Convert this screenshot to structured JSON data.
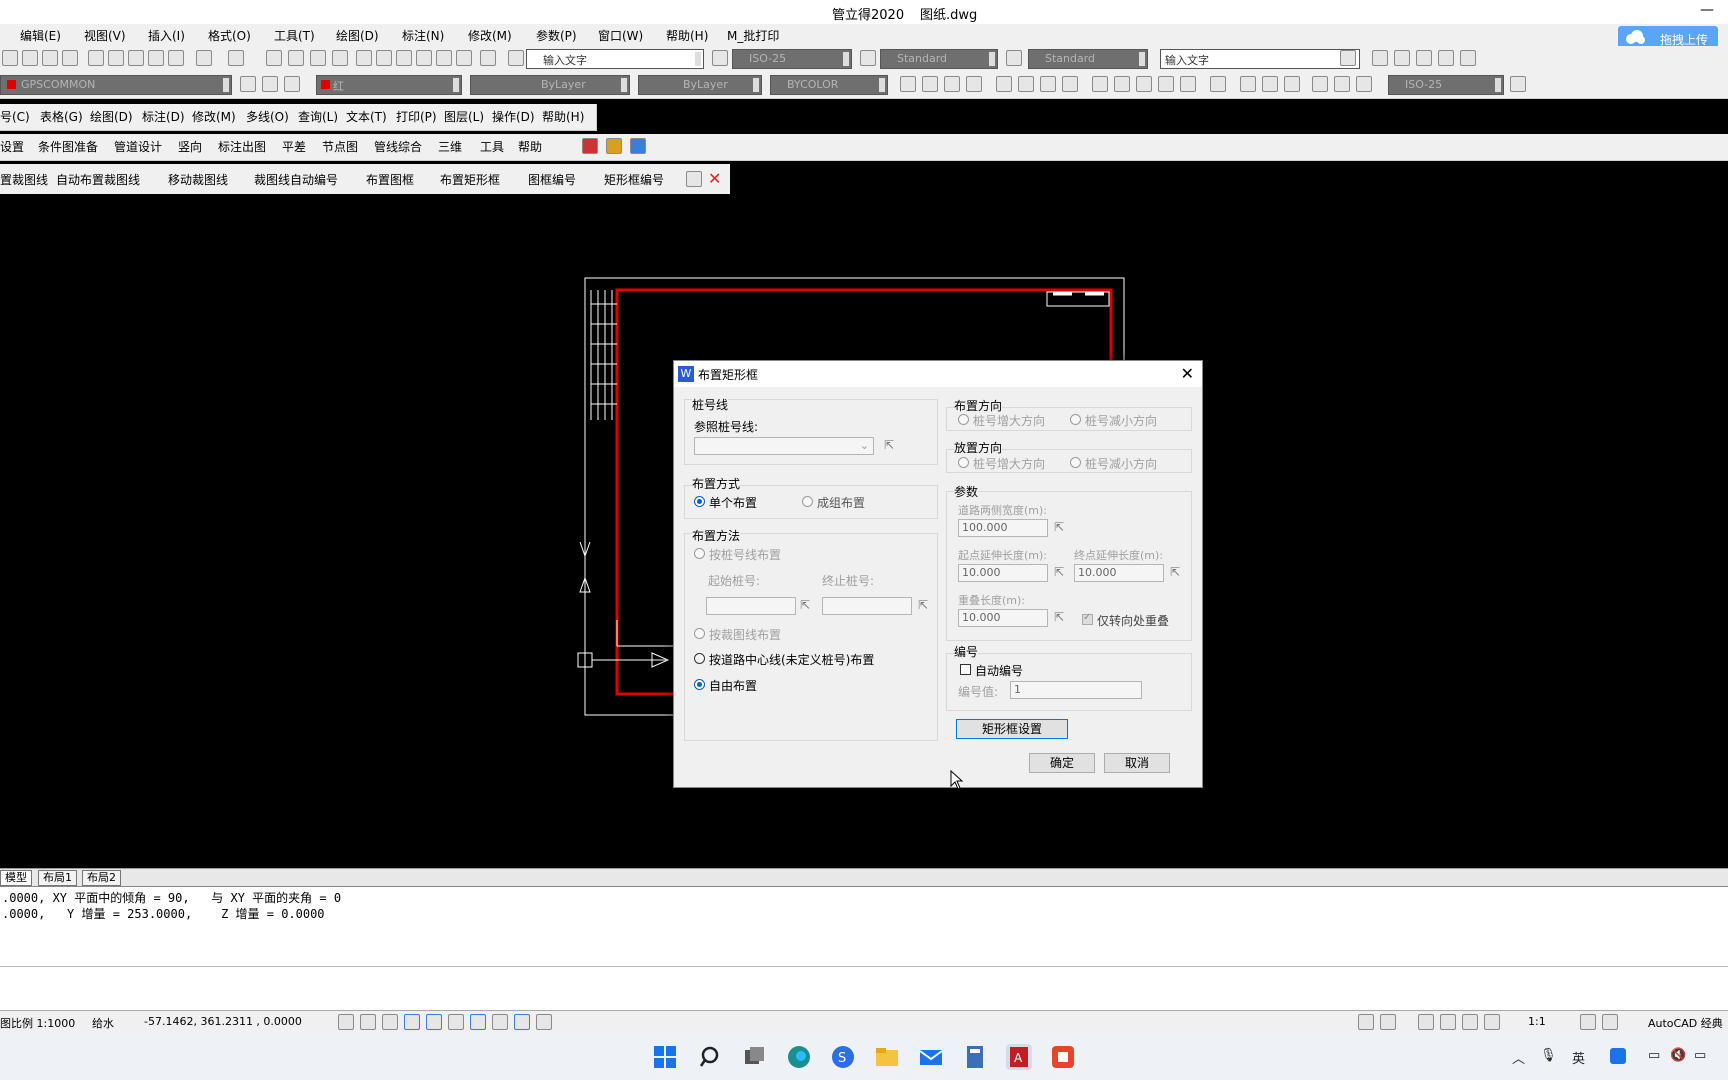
{
  "window": {
    "app_title": "管立得2020",
    "file_title": "图纸.dwg",
    "minimize": "—"
  },
  "menubar": {
    "items": [
      "编辑(E)",
      "视图(V)",
      "插入(I)",
      "格式(O)",
      "工具(T)",
      "绘图(D)",
      "标注(N)",
      "修改(M)",
      "参数(P)",
      "窗口(W)",
      "帮助(H)",
      "M_批打印"
    ],
    "upload_label": "拖拽上传"
  },
  "toolbar1": {
    "text_style": "Standard",
    "dim_style": "ISO-25",
    "table_style": "Standard",
    "multileader_style": "Standard",
    "search_placeholder": "输入文字",
    "text_input_hint": "输入文字"
  },
  "toolbar2": {
    "layer": "GPSCOMMON",
    "color": "红",
    "linetype": "ByLayer",
    "lineweight": "ByLayer",
    "plotstyle": "BYCOLOR",
    "dim_style": "ISO-25"
  },
  "menu2": {
    "items": [
      "号(C)",
      "表格(G)",
      "绘图(D)",
      "标注(D)",
      "修改(M)",
      "多线(O)",
      "查询(L)",
      "文本(T)",
      "打印(P)",
      "图层(L)",
      "操作(D)",
      "帮助(H)"
    ]
  },
  "menu3": {
    "items": [
      "设置",
      "条件图准备",
      "管道设计",
      "竖向",
      "标注出图",
      "平差",
      "节点图",
      "管线综合",
      "三维",
      "工具",
      "帮助"
    ]
  },
  "toolbar4": {
    "items": [
      "置裁图线",
      "自动布置裁图线",
      "移动裁图线",
      "裁图线自动编号",
      "布置图框",
      "布置矩形框",
      "图框编号",
      "矩形框编号"
    ]
  },
  "tabs": [
    "模型",
    "布局1",
    "布局2"
  ],
  "command": {
    "line1": ".0000, XY 平面中的倾角 = 90,   与 XY 平面的夹角 = 0",
    "line2": ".0000,   Y 增量 = 253.0000,    Z 增量 = 0.0000"
  },
  "statusbar": {
    "scale": "图比例 1:1000",
    "discipline": "给水",
    "coords": "-57.1462, 361.2311 , 0.0000",
    "annot_scale": "1:1",
    "workspace": "AutoCAD 经典"
  },
  "tray": {
    "ime": "英"
  },
  "dialog": {
    "title": "布置矩形框",
    "stake_group": {
      "title": "桩号线",
      "ref_label": "参照桩号线:"
    },
    "layout_mode": {
      "title": "布置方式",
      "single": "单个布置",
      "group": "成组布置"
    },
    "layout_method": {
      "title": "布置方法",
      "by_stake": "按桩号线布置",
      "start_label": "起始桩号:",
      "end_label": "终止桩号:",
      "by_clip": "按裁图线布置",
      "by_road": "按道路中心线(未定义桩号)布置",
      "free": "自由布置"
    },
    "arrange_dir": {
      "title": "布置方向",
      "inc": "桩号增大方向",
      "dec": "桩号减小方向"
    },
    "place_dir": {
      "title": "放置方向",
      "inc": "桩号增大方向",
      "dec": "桩号减小方向"
    },
    "params": {
      "title": "参数",
      "road_width_label": "道路两侧宽度(m):",
      "road_width": "100.000",
      "start_ext_label": "起点延伸长度(m):",
      "start_ext": "10.000",
      "end_ext_label": "终点延伸长度(m):",
      "end_ext": "10.000",
      "overlap_label": "重叠长度(m):",
      "overlap": "10.000",
      "turn_only": "仅转向处重叠"
    },
    "numbering": {
      "title": "编号",
      "auto": "自动编号",
      "value_label": "编号值:",
      "value": "1"
    },
    "rect_settings": "矩形框设置",
    "ok": "确定",
    "cancel": "取消"
  }
}
